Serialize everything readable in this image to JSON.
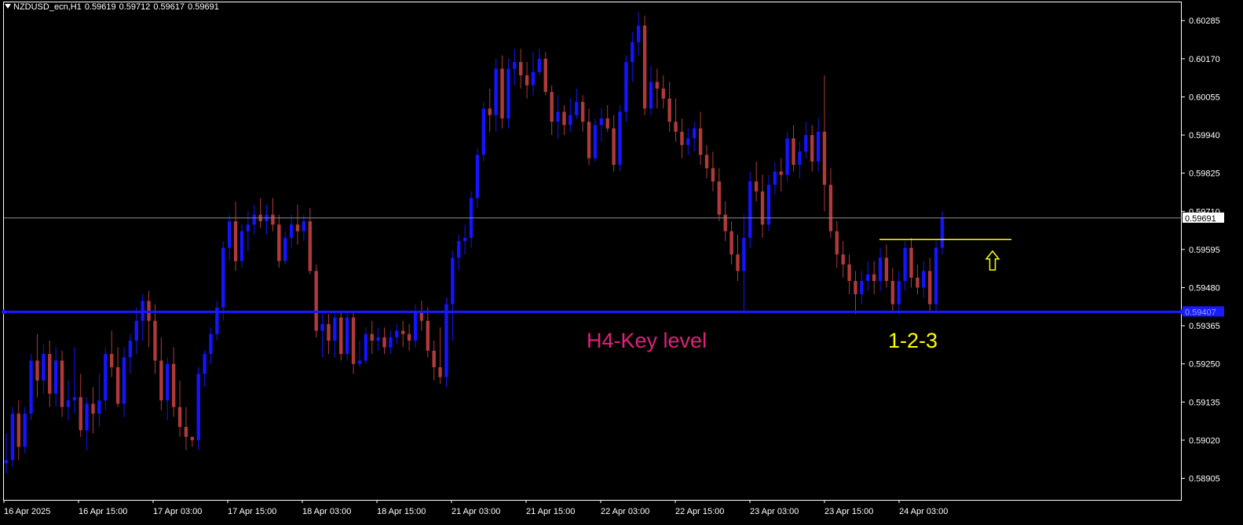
{
  "header": {
    "symbol": "NZDUSD_ecn,H1",
    "open": "0.59619",
    "high": "0.59712",
    "low": "0.59617",
    "close": "0.59691"
  },
  "annotations": {
    "key_level_label": "H4-Key level",
    "pattern_label": "1-2-3",
    "arrow_icon": "up-arrow-icon"
  },
  "colors": {
    "background": "#000000",
    "bull": "#1414ff",
    "bear": "#b03a3a",
    "key_level": "#1a1aff",
    "key_label": "#e0207a",
    "pattern": "#ffff00",
    "price_line": "#8a8f96"
  },
  "chart_data": {
    "type": "candlestick",
    "title": "NZDUSD_ecn,H1",
    "ylim": [
      0.5884,
      0.6034
    ],
    "yticks": [
      "0.60285",
      "0.60170",
      "0.60055",
      "0.59940",
      "0.59825",
      "0.59710",
      "0.59595",
      "0.59480",
      "0.59365",
      "0.59250",
      "0.59135",
      "0.59020",
      "0.58905"
    ],
    "xticks": [
      "16 Apr 2025",
      "16 Apr 15:00",
      "17 Apr 03:00",
      "17 Apr 15:00",
      "18 Apr 03:00",
      "18 Apr 15:00",
      "21 Apr 03:00",
      "21 Apr 15:00",
      "22 Apr 03:00",
      "22 Apr 15:00",
      "23 Apr 03:00",
      "23 Apr 15:00",
      "24 Apr 03:00"
    ],
    "current_price": "0.59691",
    "key_level": "0.59407",
    "resistance_level": 0.59625,
    "candles": [
      [
        0.5895,
        0.5904,
        0.5892,
        0.5896
      ],
      [
        0.5896,
        0.5912,
        0.5894,
        0.591
      ],
      [
        0.591,
        0.5914,
        0.5896,
        0.59
      ],
      [
        0.59,
        0.5912,
        0.5898,
        0.591
      ],
      [
        0.591,
        0.5928,
        0.5908,
        0.5926
      ],
      [
        0.5926,
        0.5934,
        0.5915,
        0.592
      ],
      [
        0.592,
        0.5931,
        0.5916,
        0.5928
      ],
      [
        0.5928,
        0.5932,
        0.5912,
        0.5916
      ],
      [
        0.5916,
        0.593,
        0.5912,
        0.5926
      ],
      [
        0.5926,
        0.5929,
        0.5909,
        0.5912
      ],
      [
        0.5912,
        0.592,
        0.5908,
        0.5914
      ],
      [
        0.5914,
        0.593,
        0.591,
        0.5915
      ],
      [
        0.5915,
        0.5922,
        0.5903,
        0.5905
      ],
      [
        0.5905,
        0.5915,
        0.5899,
        0.5913
      ],
      [
        0.5913,
        0.5918,
        0.5904,
        0.591
      ],
      [
        0.591,
        0.5922,
        0.5906,
        0.5914
      ],
      [
        0.5914,
        0.593,
        0.5911,
        0.5928
      ],
      [
        0.5928,
        0.5935,
        0.5921,
        0.5924
      ],
      [
        0.5924,
        0.593,
        0.5912,
        0.5913
      ],
      [
        0.5913,
        0.593,
        0.5909,
        0.5927
      ],
      [
        0.5927,
        0.5934,
        0.5922,
        0.5932
      ],
      [
        0.5932,
        0.5942,
        0.5928,
        0.5938
      ],
      [
        0.5938,
        0.5946,
        0.5932,
        0.5944
      ],
      [
        0.5944,
        0.5947,
        0.593,
        0.5938
      ],
      [
        0.5938,
        0.5943,
        0.5922,
        0.5926
      ],
      [
        0.5926,
        0.5933,
        0.5911,
        0.5914
      ],
      [
        0.5914,
        0.5927,
        0.5908,
        0.5925
      ],
      [
        0.5925,
        0.593,
        0.5909,
        0.5912
      ],
      [
        0.5912,
        0.592,
        0.5903,
        0.5906
      ],
      [
        0.5906,
        0.5912,
        0.5899,
        0.5903
      ],
      [
        0.5903,
        0.5903,
        0.59,
        0.5902
      ],
      [
        0.5902,
        0.5924,
        0.5899,
        0.5922
      ],
      [
        0.5922,
        0.5929,
        0.5918,
        0.5928
      ],
      [
        0.5928,
        0.5936,
        0.5925,
        0.5934
      ],
      [
        0.5934,
        0.5944,
        0.5932,
        0.5942
      ],
      [
        0.5942,
        0.5962,
        0.5938,
        0.596
      ],
      [
        0.596,
        0.597,
        0.5956,
        0.5968
      ],
      [
        0.5968,
        0.5974,
        0.5953,
        0.5956
      ],
      [
        0.5956,
        0.5967,
        0.5954,
        0.5965
      ],
      [
        0.5965,
        0.5971,
        0.5959,
        0.5967
      ],
      [
        0.5967,
        0.5973,
        0.5964,
        0.597
      ],
      [
        0.597,
        0.5975,
        0.5966,
        0.5968
      ],
      [
        0.5968,
        0.5973,
        0.5964,
        0.597
      ],
      [
        0.597,
        0.5975,
        0.5965,
        0.5967
      ],
      [
        0.5967,
        0.597,
        0.5954,
        0.5956
      ],
      [
        0.5956,
        0.5965,
        0.5955,
        0.5963
      ],
      [
        0.5963,
        0.597,
        0.596,
        0.5967
      ],
      [
        0.5967,
        0.5973,
        0.5961,
        0.5965
      ],
      [
        0.5965,
        0.597,
        0.5962,
        0.5968
      ],
      [
        0.5968,
        0.5972,
        0.5952,
        0.5953
      ],
      [
        0.5953,
        0.5955,
        0.5933,
        0.5935
      ],
      [
        0.5935,
        0.594,
        0.5927,
        0.5937
      ],
      [
        0.5937,
        0.594,
        0.5928,
        0.5932
      ],
      [
        0.5932,
        0.594,
        0.5927,
        0.5939
      ],
      [
        0.5939,
        0.5941,
        0.5926,
        0.5928
      ],
      [
        0.5928,
        0.5941,
        0.5926,
        0.5939
      ],
      [
        0.5939,
        0.5941,
        0.5922,
        0.5925
      ],
      [
        0.5925,
        0.5932,
        0.5924,
        0.5926
      ],
      [
        0.5926,
        0.5936,
        0.5925,
        0.5934
      ],
      [
        0.5934,
        0.5938,
        0.5928,
        0.5932
      ],
      [
        0.5932,
        0.5936,
        0.5929,
        0.5933
      ],
      [
        0.5933,
        0.5936,
        0.5928,
        0.593
      ],
      [
        0.593,
        0.5935,
        0.5928,
        0.5933
      ],
      [
        0.5933,
        0.5937,
        0.5931,
        0.5935
      ],
      [
        0.5935,
        0.5938,
        0.593,
        0.5934
      ],
      [
        0.5934,
        0.5937,
        0.5929,
        0.5932
      ],
      [
        0.5932,
        0.5943,
        0.593,
        0.5941
      ],
      [
        0.5941,
        0.5944,
        0.5935,
        0.5938
      ],
      [
        0.5938,
        0.5942,
        0.5927,
        0.5929
      ],
      [
        0.5929,
        0.5932,
        0.592,
        0.5924
      ],
      [
        0.5924,
        0.5936,
        0.5919,
        0.5921
      ],
      [
        0.5921,
        0.5945,
        0.5918,
        0.5943
      ],
      [
        0.5943,
        0.5959,
        0.5932,
        0.5957
      ],
      [
        0.5957,
        0.5964,
        0.5953,
        0.5962
      ],
      [
        0.5962,
        0.5967,
        0.5958,
        0.5963
      ],
      [
        0.5963,
        0.5977,
        0.596,
        0.5975
      ],
      [
        0.5975,
        0.599,
        0.5972,
        0.5988
      ],
      [
        0.5988,
        0.6004,
        0.5986,
        0.6002
      ],
      [
        0.6002,
        0.6008,
        0.5995,
        0.6
      ],
      [
        0.6,
        0.6017,
        0.5995,
        0.6014
      ],
      [
        0.6014,
        0.6018,
        0.5996,
        0.5999
      ],
      [
        0.5999,
        0.6017,
        0.5996,
        0.6014
      ],
      [
        0.6014,
        0.602,
        0.6009,
        0.6016
      ],
      [
        0.6016,
        0.602,
        0.6008,
        0.6012
      ],
      [
        0.6012,
        0.6016,
        0.6005,
        0.6009
      ],
      [
        0.6009,
        0.6019,
        0.6006,
        0.6013
      ],
      [
        0.6013,
        0.602,
        0.6012,
        0.6017
      ],
      [
        0.6017,
        0.6019,
        0.6006,
        0.6007
      ],
      [
        0.6007,
        0.6009,
        0.5994,
        0.5998
      ],
      [
        0.5998,
        0.6006,
        0.5993,
        0.6001
      ],
      [
        0.6001,
        0.6003,
        0.5994,
        0.5997
      ],
      [
        0.5997,
        0.6005,
        0.5995,
        0.6
      ],
      [
        0.6,
        0.6008,
        0.5999,
        0.6004
      ],
      [
        0.6004,
        0.6006,
        0.5995,
        0.5998
      ],
      [
        0.5998,
        0.6002,
        0.5985,
        0.5987
      ],
      [
        0.5987,
        0.5999,
        0.5986,
        0.5997
      ],
      [
        0.5997,
        0.6002,
        0.5992,
        0.5999
      ],
      [
        0.5999,
        0.6003,
        0.5995,
        0.5996
      ],
      [
        0.5996,
        0.6,
        0.5983,
        0.5985
      ],
      [
        0.5985,
        0.6003,
        0.5983,
        0.6001
      ],
      [
        0.6001,
        0.6018,
        0.5998,
        0.6016
      ],
      [
        0.6016,
        0.6025,
        0.601,
        0.6022
      ],
      [
        0.6022,
        0.6031,
        0.6018,
        0.6027
      ],
      [
        0.6027,
        0.603,
        0.6,
        0.6002
      ],
      [
        0.6002,
        0.6015,
        0.6,
        0.601
      ],
      [
        0.601,
        0.6014,
        0.6002,
        0.6008
      ],
      [
        0.6008,
        0.6012,
        0.6002,
        0.6005
      ],
      [
        0.6005,
        0.601,
        0.5995,
        0.5998
      ],
      [
        0.5998,
        0.6005,
        0.5992,
        0.5995
      ],
      [
        0.5995,
        0.5999,
        0.5987,
        0.5991
      ],
      [
        0.5991,
        0.5996,
        0.5988,
        0.5993
      ],
      [
        0.5993,
        0.5998,
        0.5989,
        0.5996
      ],
      [
        0.5996,
        0.6001,
        0.5985,
        0.5988
      ],
      [
        0.5988,
        0.5991,
        0.5981,
        0.5984
      ],
      [
        0.5984,
        0.5989,
        0.5977,
        0.598
      ],
      [
        0.598,
        0.5984,
        0.5968,
        0.597
      ],
      [
        0.597,
        0.5974,
        0.5962,
        0.5965
      ],
      [
        0.5965,
        0.5968,
        0.5955,
        0.5958
      ],
      [
        0.5958,
        0.5964,
        0.595,
        0.5953
      ],
      [
        0.5953,
        0.597,
        0.5941,
        0.5963
      ],
      [
        0.5963,
        0.5983,
        0.596,
        0.598
      ],
      [
        0.598,
        0.5986,
        0.5974,
        0.5977
      ],
      [
        0.5977,
        0.5982,
        0.5963,
        0.5967
      ],
      [
        0.5967,
        0.5982,
        0.5965,
        0.5979
      ],
      [
        0.5979,
        0.5986,
        0.5976,
        0.5983
      ],
      [
        0.5983,
        0.5987,
        0.5977,
        0.5982
      ],
      [
        0.5982,
        0.5995,
        0.598,
        0.5993
      ],
      [
        0.5993,
        0.5997,
        0.5983,
        0.5985
      ],
      [
        0.5985,
        0.5992,
        0.5981,
        0.5989
      ],
      [
        0.5989,
        0.5998,
        0.5987,
        0.5994
      ],
      [
        0.5994,
        0.5997,
        0.5983,
        0.5986
      ],
      [
        0.5986,
        0.5999,
        0.5983,
        0.5995
      ],
      [
        0.5995,
        0.6012,
        0.5971,
        0.5979
      ],
      [
        0.5979,
        0.5984,
        0.5963,
        0.5965
      ],
      [
        0.5965,
        0.5968,
        0.5954,
        0.5958
      ],
      [
        0.5958,
        0.5962,
        0.5951,
        0.5955
      ],
      [
        0.5955,
        0.5958,
        0.5946,
        0.595
      ],
      [
        0.595,
        0.5953,
        0.594,
        0.5946
      ],
      [
        0.5946,
        0.5953,
        0.5943,
        0.595
      ],
      [
        0.595,
        0.5956,
        0.5947,
        0.5952
      ],
      [
        0.5952,
        0.5956,
        0.5946,
        0.595
      ],
      [
        0.595,
        0.596,
        0.5947,
        0.5957
      ],
      [
        0.5957,
        0.5961,
        0.5948,
        0.595
      ],
      [
        0.595,
        0.5954,
        0.5941,
        0.5943
      ],
      [
        0.5943,
        0.5953,
        0.594,
        0.595
      ],
      [
        0.595,
        0.5962,
        0.5947,
        0.596
      ],
      [
        0.596,
        0.5963,
        0.5948,
        0.5951
      ],
      [
        0.5951,
        0.5955,
        0.5946,
        0.5948
      ],
      [
        0.5948,
        0.5956,
        0.5945,
        0.5953
      ],
      [
        0.5953,
        0.5957,
        0.5941,
        0.5943
      ],
      [
        0.5943,
        0.5962,
        0.5941,
        0.596
      ],
      [
        0.596,
        0.5971,
        0.5958,
        0.5969
      ]
    ]
  }
}
